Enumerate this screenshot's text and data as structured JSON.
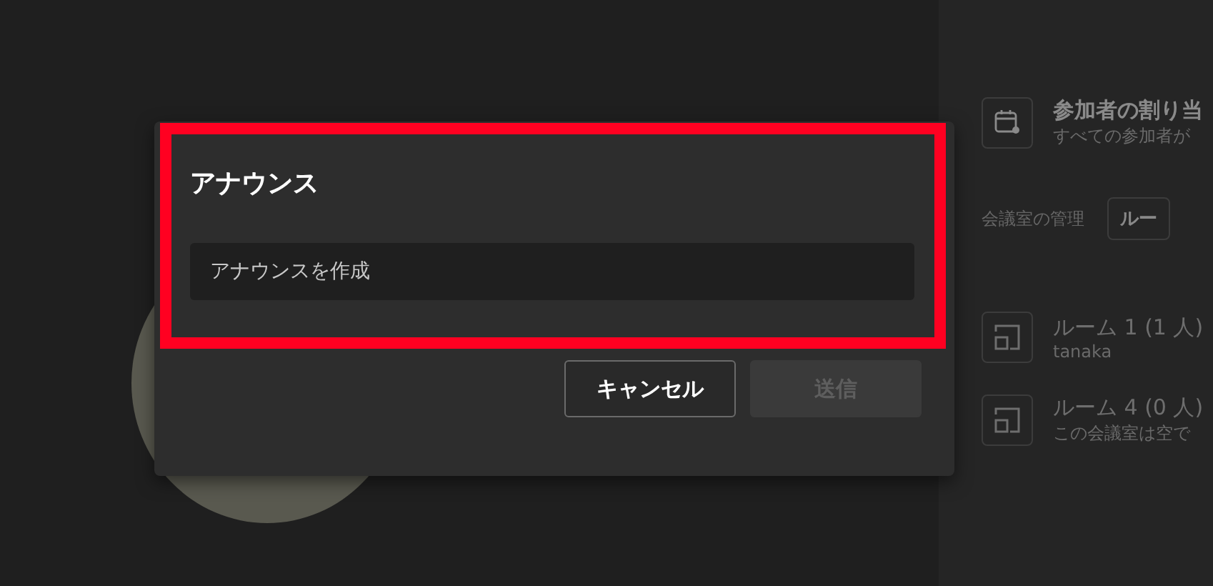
{
  "side_panel": {
    "assign": {
      "title": "参加者の割り当",
      "subtitle": "すべての参加者が"
    },
    "manage": {
      "label": "会議室の管理",
      "button": "ルー"
    },
    "rooms": [
      {
        "name": "ルーム 1 (1 人)",
        "detail": "tanaka"
      },
      {
        "name": "ルーム 4 (0 人)",
        "detail": "この会議室は空で"
      }
    ]
  },
  "dialog": {
    "title": "アナウンス",
    "highlighted": true,
    "input": {
      "placeholder": "アナウンスを作成"
    },
    "buttons": [
      {
        "label": "キャンセル",
        "disabled": false
      },
      {
        "label": "送信",
        "disabled": true
      }
    ]
  }
}
